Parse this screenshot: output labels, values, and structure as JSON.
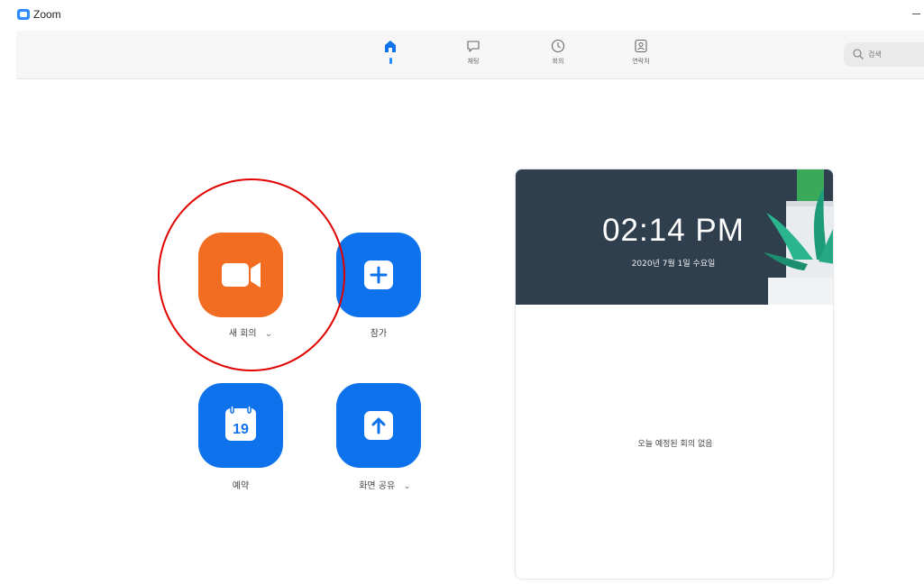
{
  "app": {
    "title": "Zoom"
  },
  "nav": {
    "home_label": "",
    "chat_label": "채팅",
    "meetings_label": "회의",
    "contacts_label": "연락처"
  },
  "search": {
    "placeholder": "검색"
  },
  "actions": {
    "new_meeting": {
      "label": "새 회의",
      "chevron": "⌄"
    },
    "join": {
      "label": "참가"
    },
    "schedule": {
      "label": "예약",
      "day": "19"
    },
    "share_screen": {
      "label": "화면 공유",
      "chevron": "⌄"
    }
  },
  "card": {
    "time": "02:14 PM",
    "date": "2020년 7월 1일 수요일",
    "empty_message": "오늘 예정된 회의 없음"
  },
  "colors": {
    "accent_blue": "#0e72ed",
    "new_meeting_orange": "#f26d21",
    "highlight_red": "#e00000",
    "card_header": "#2f3f4e"
  },
  "icons": {
    "home": "home-icon",
    "chat": "chat-bubble-icon",
    "meetings": "clock-icon",
    "contacts": "contact-card-icon",
    "search": "search-icon",
    "new_meeting": "video-camera-icon",
    "join": "plus-icon",
    "schedule": "calendar-icon",
    "share": "share-up-arrow-icon"
  }
}
